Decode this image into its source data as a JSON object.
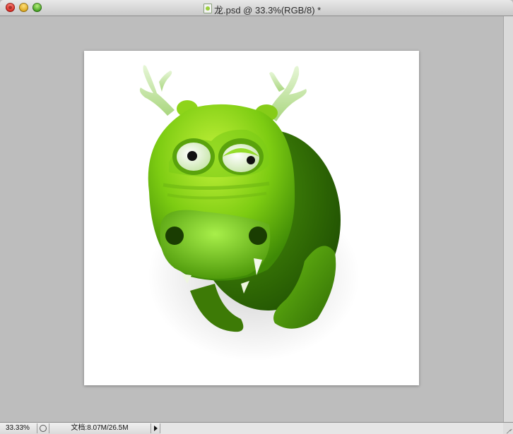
{
  "window": {
    "title": "龙.psd @ 33.3%(RGB/8) *",
    "controls": [
      "close",
      "minimize",
      "zoom"
    ]
  },
  "document": {
    "artwork": "green-dragon-illustration",
    "background_color": "#ffffff",
    "canvas_color": "#bdbdbd",
    "colors": {
      "body_light": "#a6e22a",
      "body_mid": "#5cae0a",
      "body_dark": "#2f6d04",
      "antler": "#cfe9b3"
    }
  },
  "statusbar": {
    "zoom": "33.33%",
    "doc_size": "文档:8.07M/26.5M"
  }
}
